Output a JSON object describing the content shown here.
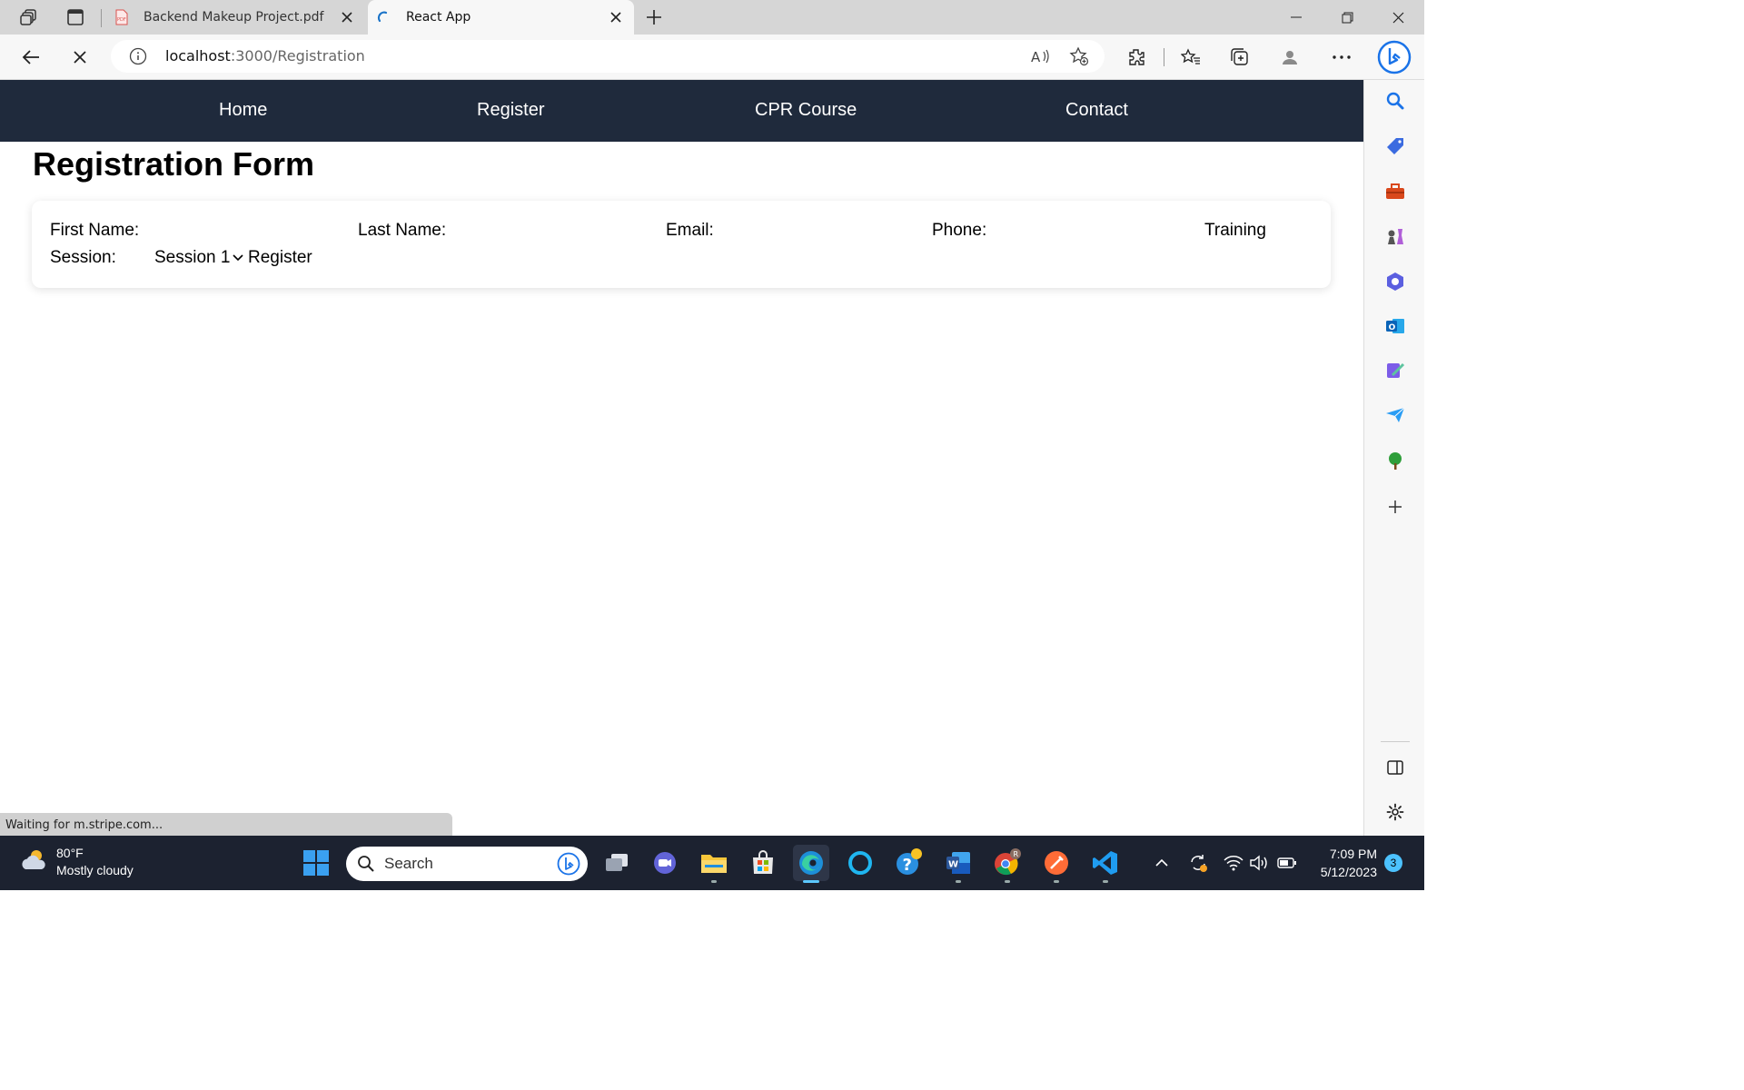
{
  "browser": {
    "tabs": [
      {
        "title": "Backend Makeup Project.pdf",
        "active": false
      },
      {
        "title": "React App",
        "active": true
      }
    ],
    "url_host": "localhost",
    "url_path": ":3000/Registration",
    "status_text": "Waiting for m.stripe.com...",
    "sidebar_icons": [
      "search-icon",
      "shopping-tag-icon",
      "tools-icon",
      "games-icon",
      "office-icon",
      "outlook-icon",
      "designer-icon",
      "send-icon",
      "tree-icon",
      "add-icon",
      "split-screen-icon",
      "settings-icon"
    ]
  },
  "page": {
    "nav": [
      "Home",
      "Register",
      "CPR Course",
      "Contact"
    ],
    "title": "Registration Form",
    "form": {
      "first_name_label": "First Name:",
      "last_name_label": "Last Name:",
      "email_label": "Email:",
      "phone_label": "Phone:",
      "training_label_line1": "Training",
      "training_label_line2": "Session:",
      "session_value": "Session 1",
      "submit_label": "Register"
    }
  },
  "taskbar": {
    "weather_temp": "80°F",
    "weather_desc": "Mostly cloudy",
    "search_placeholder": "Search",
    "time": "7:09 PM",
    "date": "5/12/2023",
    "notification_count": "3",
    "colors": {
      "taskbar_bg": "#1c2230",
      "nav_bg": "#1f2a3c",
      "accent": "#5cc8ff"
    }
  }
}
